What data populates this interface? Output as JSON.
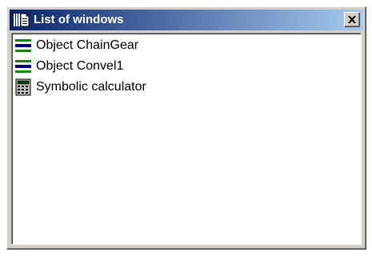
{
  "window": {
    "title": "List of windows",
    "app_icon": "window-list-icon",
    "close_icon": "close-icon"
  },
  "list": {
    "items": [
      {
        "label": "Object ChainGear",
        "icon": "object-icon"
      },
      {
        "label": "Object Convel1",
        "icon": "object-icon"
      },
      {
        "label": "Symbolic calculator",
        "icon": "calculator-icon"
      }
    ]
  },
  "colors": {
    "titlebar_start": "#0a246a",
    "titlebar_end": "#a6caf0",
    "face": "#d4d0c8",
    "object_icon_green": "#0a8a0a",
    "object_icon_navy": "#000080"
  }
}
